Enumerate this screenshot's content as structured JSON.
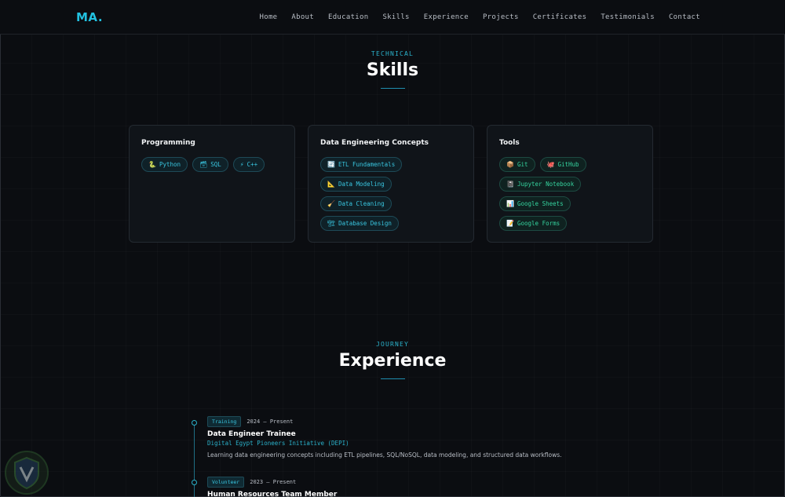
{
  "logo": "MA.",
  "nav": [
    "Home",
    "About",
    "Education",
    "Skills",
    "Experience",
    "Projects",
    "Certificates",
    "Testimonials",
    "Contact"
  ],
  "skills": {
    "eyebrow": "TECHNICAL",
    "title": "Skills",
    "cards": [
      {
        "title": "Programming",
        "chips": [
          {
            "icon": "🐍",
            "label": "Python"
          },
          {
            "icon": "🗃",
            "label": "SQL"
          },
          {
            "icon": "⚡",
            "label": "C++"
          }
        ]
      },
      {
        "title": "Data Engineering Concepts",
        "chips": [
          {
            "icon": "🔄",
            "label": "ETL Fundamentals"
          },
          {
            "icon": "📐",
            "label": "Data Modeling"
          },
          {
            "icon": "🧹",
            "label": "Data Cleaning"
          },
          {
            "icon": "🏗",
            "label": "Database Design"
          }
        ]
      },
      {
        "title": "Tools",
        "chips": [
          {
            "icon": "📦",
            "label": "Git"
          },
          {
            "icon": "🐙",
            "label": "GitHub"
          },
          {
            "icon": "📓",
            "label": "Jupyter Notebook"
          },
          {
            "icon": "📊",
            "label": "Google Sheets"
          },
          {
            "icon": "📝",
            "label": "Google Forms"
          }
        ]
      }
    ]
  },
  "experience": {
    "eyebrow": "JOURNEY",
    "title": "Experience",
    "items": [
      {
        "badge": "Training",
        "date": "2024 – Present",
        "role": "Data Engineer Trainee",
        "org": "Digital Egypt Pioneers Initiative (DEPI)",
        "desc": "Learning data engineering concepts including ETL pipelines, SQL/NoSQL, data modeling, and structured data workflows."
      },
      {
        "badge": "Volunteer",
        "date": "2023 – Present",
        "role": "Human Resources Team Member"
      }
    ]
  },
  "colors": {
    "accent": "#22c1e0",
    "accent_green": "#35d39e",
    "background": "#0b0d11"
  }
}
